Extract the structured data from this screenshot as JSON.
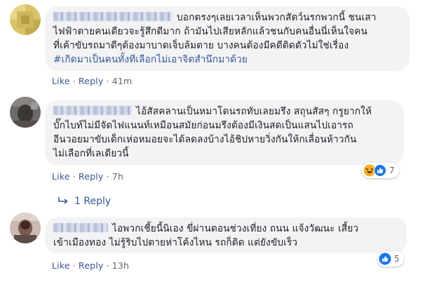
{
  "comments": [
    {
      "lines": [
        "บอกตรงๆเลยเวลาเห็นพวกสัตว์นรกพวกนี้ ชนเสา",
        "ไฟฟ้าตายคนเดียวจะรู้สึกดีมาก ถ้ามันไปเสียหลักแล้วชนกับคนอื่นนี่เห็นใจคน",
        "ที่เค้าขับรถมาดีๆต้องมาบาดเจ็บล้มตาย บางคนต้องมีคดีติดตัวไม่ใช่เรื่อง"
      ],
      "hashtag": "#เกิดมาเป็นคนทั้งทีเลือกไม่เอาจิตสำนึกมาด้วย",
      "like_label": "Like",
      "reply_label": "Reply",
      "time": "41m"
    },
    {
      "lines": [
        "ไอ้สัสคลานเป็นหมาโดนรถทับเลยมรึง สถุนสัสๆ กรูยากให้",
        "บั๊กไบท์ไม่มีจัดไฟแนนท์เหมือนสมัยก่อนมรึงต้องมีเงินสดเป็นแสนไปเอารถ",
        "อีนวอยมาขับเด็กเห่อหมอยจะได้ลดลงบ้างไอ้ชิปหายวิ่งกันให้กเลื่อนห้าวกัน",
        "ไม่เลือกที่เลเดียวนี้"
      ],
      "like_label": "Like",
      "reply_label": "Reply",
      "time": "7h",
      "reaction_count": "7",
      "replies_label": "1 Reply"
    },
    {
      "lines": [
        "ไอพวกเชี้ยนี้นิเอง ขี่ผ่านตอนช่วงเที่ยง ถนน แจ้งวัฒนะ เสี้ยว",
        "เข้าเมืองทอง ไม่รู้ริบไปตายห่าโค้งไหน รถก็ติด แต่ยังขับเร็ว"
      ],
      "like_label": "Like",
      "reply_label": "Reply",
      "time": "13h",
      "reaction_count": "5"
    }
  ],
  "colors": {
    "bubble": "#f2f3f5",
    "link": "#385898",
    "meta": "#606770",
    "text": "#1c1e21",
    "like_blue": "#1877f2",
    "haha_yellow": "#f7b125"
  },
  "icons": {
    "reply_arrow": "reply-arrow-icon",
    "like_reaction": "like-reaction-icon",
    "haha_reaction": "haha-reaction-icon"
  }
}
